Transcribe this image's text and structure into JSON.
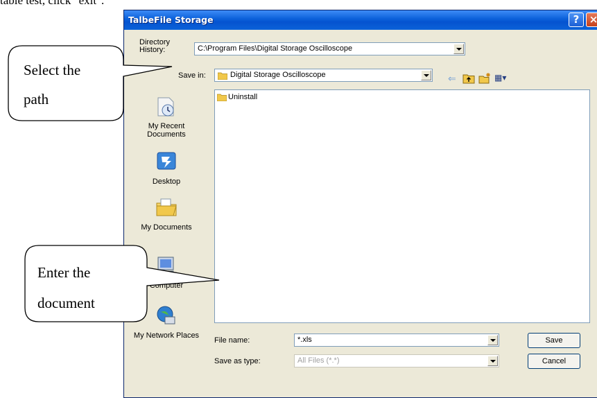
{
  "doc": {
    "top_text": "table test, click \"exit\"."
  },
  "window": {
    "title": "TalbeFile Storage",
    "help_glyph": "?",
    "close_glyph": "×"
  },
  "directory_history": {
    "label": "Directory History:",
    "value": "C:\\Program Files\\Digital Storage Oscilloscope"
  },
  "save_in": {
    "label": "Save in:",
    "value": "Digital Storage Oscilloscope"
  },
  "toolbar": {
    "icons": [
      "back-arrow-icon",
      "up-folder-icon",
      "new-folder-icon",
      "view-menu-icon"
    ],
    "back_glyph": "⇐",
    "view_glyph": "▦▾"
  },
  "places": [
    {
      "icon": "recent-documents-icon",
      "label": "My Recent Documents"
    },
    {
      "icon": "desktop-icon",
      "label": "Desktop"
    },
    {
      "icon": "my-documents-icon",
      "label": "My Documents"
    },
    {
      "icon": "my-computer-icon",
      "label": "Computer"
    },
    {
      "icon": "network-places-icon",
      "label": "My Network Places"
    }
  ],
  "file_list": {
    "items": [
      {
        "icon": "folder-icon",
        "name": "Uninstall"
      }
    ]
  },
  "file_name": {
    "label": "File name:",
    "value": "*.xls"
  },
  "save_as_type": {
    "label": "Save as type:",
    "value": "All Files (*.*)"
  },
  "buttons": {
    "save": "Save",
    "cancel": "Cancel"
  },
  "callouts": {
    "select_path": {
      "line1": "Select the",
      "line2": "path"
    },
    "enter_doc": {
      "line1": "Enter the",
      "line2": "document"
    }
  },
  "colors": {
    "titlebar": "#0a5fd9",
    "dialog_bg": "#ece9d8",
    "field_border": "#7f9db9"
  }
}
